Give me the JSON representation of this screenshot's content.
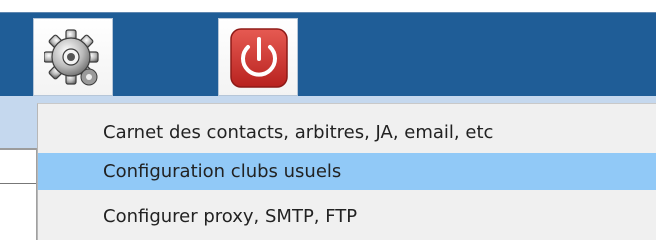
{
  "toolbar": {
    "buttons": [
      {
        "id": "settings",
        "icon": "gear-icon"
      },
      {
        "id": "power",
        "icon": "power-icon",
        "color": "#d83a35"
      }
    ],
    "background": "#1f5d97"
  },
  "menu": {
    "items": [
      {
        "label": "Carnet des contacts, arbitres, JA, email, etc",
        "highlighted": false
      },
      {
        "label": "Configuration clubs usuels",
        "highlighted": true
      },
      {
        "label": "Configurer proxy, SMTP, FTP",
        "highlighted": false
      }
    ],
    "highlight_color": "#91c9f7"
  }
}
